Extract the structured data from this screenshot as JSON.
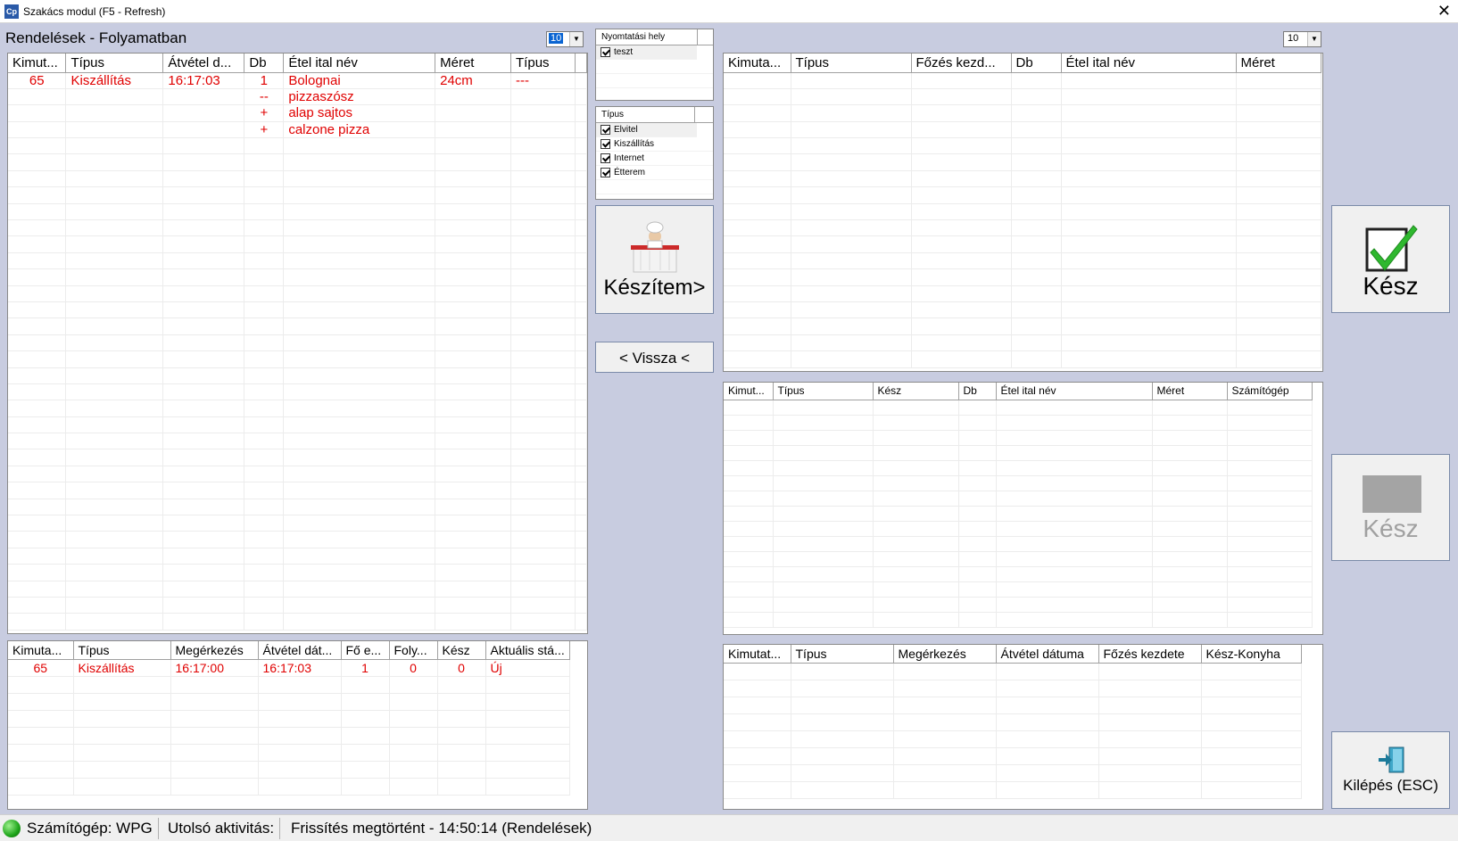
{
  "window": {
    "title": "Szakács modul (F5 - Refresh)",
    "icon": "Cp"
  },
  "heading": "Rendelések - Folyamatban",
  "combos": {
    "left": "10",
    "right": "10"
  },
  "orders_grid": {
    "columns": [
      "Kimut...",
      "Típus",
      "Átvétel d...",
      "Db",
      "Étel ital név",
      "Méret",
      "Típus"
    ],
    "rows": [
      [
        "65",
        "Kiszállítás",
        "16:17:03",
        "1",
        "Bolognai",
        "24cm",
        "---"
      ],
      [
        "",
        "",
        "",
        "--",
        "pizzaszósz",
        "",
        ""
      ],
      [
        "",
        "",
        "",
        "+",
        "alap sajtos",
        "",
        ""
      ],
      [
        "",
        "",
        "",
        "+",
        "calzone pizza",
        "",
        ""
      ]
    ]
  },
  "summary_grid": {
    "columns": [
      "Kimuta...",
      "Típus",
      "Megérkezés",
      "Átvétel dát...",
      "Fő e...",
      "Foly...",
      "Kész",
      "Aktuális stá..."
    ],
    "rows": [
      [
        "65",
        "Kiszállítás",
        "16:17:00",
        "16:17:03",
        "1",
        "0",
        "0",
        "Új"
      ]
    ]
  },
  "print_panel": {
    "header": "Nyomtatási hely",
    "items": [
      "teszt"
    ]
  },
  "type_panel": {
    "header": "Típus",
    "items": [
      "Elvitel",
      "Kiszállítás",
      "Internet",
      "Étterem"
    ]
  },
  "buttons": {
    "keszitem": "Készítem>",
    "vissza": "< Vissza <",
    "kesz1": "Kész",
    "kesz2": "Kész",
    "kilepes": "Kilépés (ESC)"
  },
  "cooking_grid": {
    "columns": [
      "Kimuta...",
      "Típus",
      "Főzés kezd...",
      "Db",
      "Étel ital név",
      "Méret"
    ]
  },
  "done_grid": {
    "columns": [
      "Kimut...",
      "Típus",
      "Kész",
      "Db",
      "Étel ital név",
      "Méret",
      "Számítógép"
    ]
  },
  "kitchen_grid": {
    "columns": [
      "Kimutat...",
      "Típus",
      "Megérkezés",
      "Átvétel dátuma",
      "Főzés kezdete",
      "Kész-Konyha"
    ]
  },
  "status": {
    "computer": "Számítógép: WPG",
    "last_activity": "Utolsó aktivitás:",
    "refresh": "Frissítés megtörtént - 14:50:14 (Rendelések)"
  },
  "colors": {
    "accent": "#0a64d2",
    "row_text": "#e00000",
    "check": "#2fb82f",
    "background": "#c8cce0"
  }
}
